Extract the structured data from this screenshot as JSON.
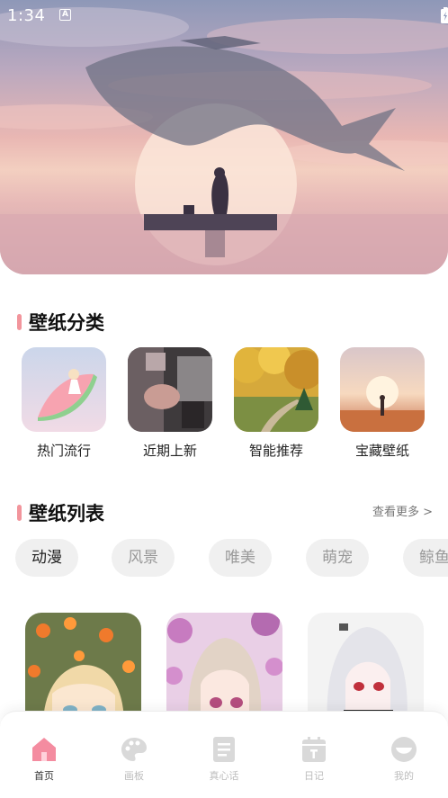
{
  "status_bar": {
    "time": "1:34",
    "notification_icon": "A"
  },
  "hero": {
    "icon": "whale-banner-image"
  },
  "categories_section": {
    "title": "壁纸分类",
    "items": [
      {
        "label": "热门流行",
        "icon": "watermelon-image"
      },
      {
        "label": "近期上新",
        "icon": "room-image"
      },
      {
        "label": "智能推荐",
        "icon": "autumn-forest-image"
      },
      {
        "label": "宝藏壁纸",
        "icon": "sunset-girl-image"
      }
    ]
  },
  "list_section": {
    "title": "壁纸列表",
    "more_label": "查看更多 >",
    "tags": [
      "动漫",
      "风景",
      "唯美",
      "萌宠",
      "鲸鱼"
    ],
    "active_tag_index": 0
  },
  "bottom_nav": {
    "items": [
      {
        "label": "首页",
        "icon": "home-icon",
        "active": true
      },
      {
        "label": "画板",
        "icon": "palette-icon",
        "active": false
      },
      {
        "label": "真心话",
        "icon": "document-icon",
        "active": false
      },
      {
        "label": "日记",
        "icon": "calendar-icon",
        "active": false
      },
      {
        "label": "我的",
        "icon": "profile-icon",
        "active": false
      }
    ]
  },
  "colors": {
    "accent": "#f2959c",
    "nav_active": "#f48ca0",
    "nav_inactive": "#d9d9d9"
  }
}
